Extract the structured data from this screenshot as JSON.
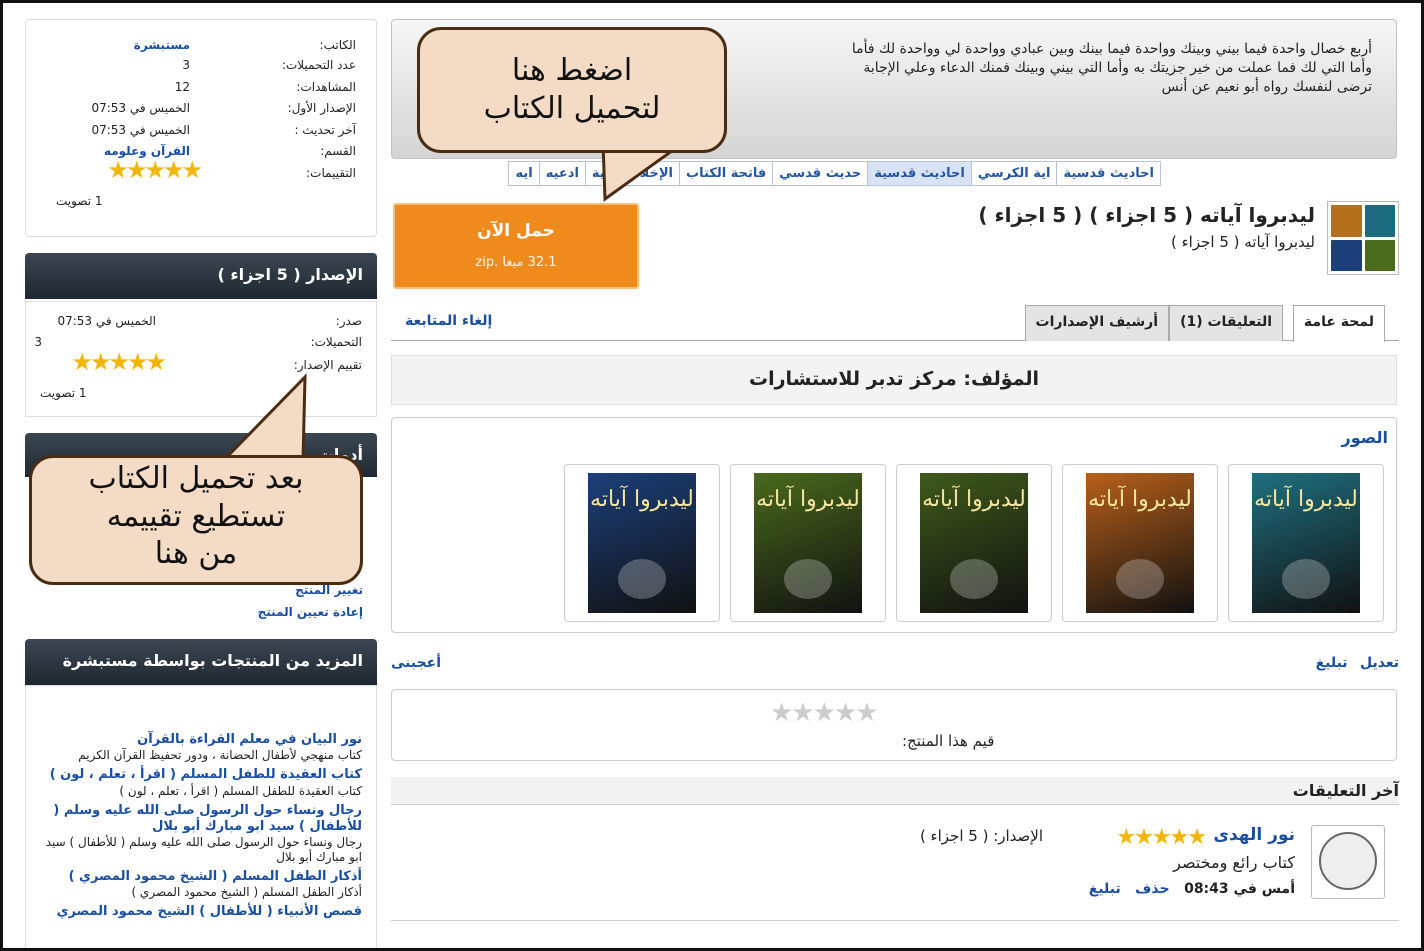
{
  "quote": {
    "text_line1": "أربع خصال واحدة فيما بيني وبينك وواحدة فيما بينك وبين عبادي وواحدة لي وواحدة لك فأما",
    "text_line2": "وأما التي لك فما عملت من خير جزيتك به وأما التي بيني وبينك فمنك الدعاء وعلي الإجابة",
    "text_line3": "ترضى لنفسك رواه أبو نعيم عن أنس"
  },
  "tags": [
    "احاديث قدسية",
    "اية الكرسي",
    "احاديث قدسية",
    "حديث قدسي",
    "فاتحة الكتاب",
    "الإخلاص",
    "اية",
    "ادعيه",
    "ايه"
  ],
  "product": {
    "title": "ليدبروا آياته ( 5 اجزاء ) ( 5 اجزاء )",
    "subtitle": "ليدبروا آياته ( 5 اجزاء )",
    "download_label": "حمل الآن",
    "download_size": "32.1 ميغا .zip"
  },
  "tabs": {
    "overview": "لمحة عامة",
    "comments": "التعليقات (1)",
    "archive": "أرشيف الإصدارات",
    "unfollow": "إلغاء المتابعة"
  },
  "author": "المؤلف: مركز تدبر للاستشارات",
  "gallery": {
    "title": "الصور",
    "cover_text": "ليدبروا آياته",
    "covers": [
      "#1f7080",
      "#b8601a",
      "#3f5a1a",
      "#4a6a1c",
      "#1c3f7a"
    ]
  },
  "actions": {
    "edit": "تعديل",
    "report": "تبليغ",
    "like": "أعجبنى"
  },
  "rating": {
    "label": "قيم هذا المنتج:",
    "stars_empty": "★★★★★"
  },
  "comments": {
    "heading": "آخر التعليقات",
    "name": "نور الهدى",
    "stars": "★★★★★",
    "release": "الإصدار: ( 5 اجزاء )",
    "text": "كتاب رائع ومختصر",
    "time": "أمس في 08:43",
    "delete": "حذف",
    "report": "تبليغ"
  },
  "info": {
    "author_label": "الكاتب:",
    "author_value": "مستبشرة",
    "downloads_label": "عدد التحميلات:",
    "downloads_value": "3",
    "views_label": "المشاهدات:",
    "views_value": "12",
    "first_label": "الإصدار الأول:",
    "first_value": "الخميس في 07:53",
    "updated_label": "آخر تحديث :",
    "updated_value": "الخميس في 07:53",
    "category_label": "القسم:",
    "category_value": "القرآن وعلومه",
    "ratings_label": "التقييمات:",
    "stars": "★★★★★",
    "votes": "1 تصويت"
  },
  "release": {
    "heading": "الإصدار ( 5 اجزاء )",
    "issued_label": "صدر:",
    "issued_value": "الخميس في 07:53",
    "downloads_label": "التحميلات:",
    "downloads_value": "3",
    "rating_label": "تقييم الإصدار:",
    "stars": "★★★★★",
    "votes": "1 تصويت"
  },
  "tools": {
    "heading": "أدوات",
    "item1": "تغيير المنتج",
    "item2": "إعادة تعيين المنتج"
  },
  "more": {
    "heading": "المزيد من المنتجات بواسطة مستبشرة",
    "items": [
      {
        "title": "نور البيان في معلم القراءة بالقرآن",
        "desc": "كتاب منهجي لأطفال الحضانة ، ودور تحفيظ القرآن الكريم"
      },
      {
        "title": "كتاب العقيدة للطفل المسلم ( اقرأ ، تعلم ، لون )",
        "desc": "كتاب العقيدة للطفل المسلم ( اقرأ ، تعلم ، لون )"
      },
      {
        "title": "رجال ونساء حول الرسول صلى الله عليه وسلم ( للأطفال ) سيد ابو مبارك أبو بلال",
        "desc": "رجال ونساء حول الرسول صلى الله عليه وسلم ( للأطفال ) سيد ابو مبارك أبو بلال"
      },
      {
        "title": "أذكار الطفل المسلم ( الشيخ محمود المصري )",
        "desc": "أذكار الطفل المسلم ( الشيخ محمود المصري )"
      },
      {
        "title": "قصص الأنبياء ( للأطفال ) الشيخ محمود المصري",
        "desc": ""
      }
    ]
  },
  "callouts": {
    "download_line1": "اضغط هنا",
    "download_line2": "لتحميل الكتاب",
    "rate_line1": "بعد تحميل الكتاب",
    "rate_line2": "تستطيع تقييمه",
    "rate_line3": "من هنا"
  }
}
